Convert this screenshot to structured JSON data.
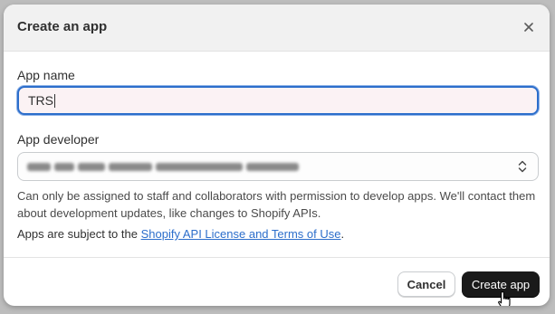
{
  "dialog": {
    "title": "Create an app",
    "close_icon": "close-icon"
  },
  "app_name": {
    "label": "App name",
    "value": "TRS"
  },
  "app_developer": {
    "label": "App developer",
    "selected_value": "",
    "value_redacted": true,
    "help_text": "Can only be assigned to staff and collaborators with permission to develop apps. We'll contact them about development updates, like changes to Shopify APIs."
  },
  "terms": {
    "prefix": "Apps are subject to the ",
    "link_text": "Shopify API License and Terms of Use",
    "suffix": "."
  },
  "footer": {
    "cancel_label": "Cancel",
    "create_label": "Create app"
  },
  "colors": {
    "primary_button": "#1a1a1a",
    "link": "#2c6ecb",
    "focus_ring": "#2c6ecb"
  },
  "icons": {
    "close": "close-icon",
    "select": "chevron-up-down-icon",
    "pointer": "hand-pointer-icon"
  }
}
